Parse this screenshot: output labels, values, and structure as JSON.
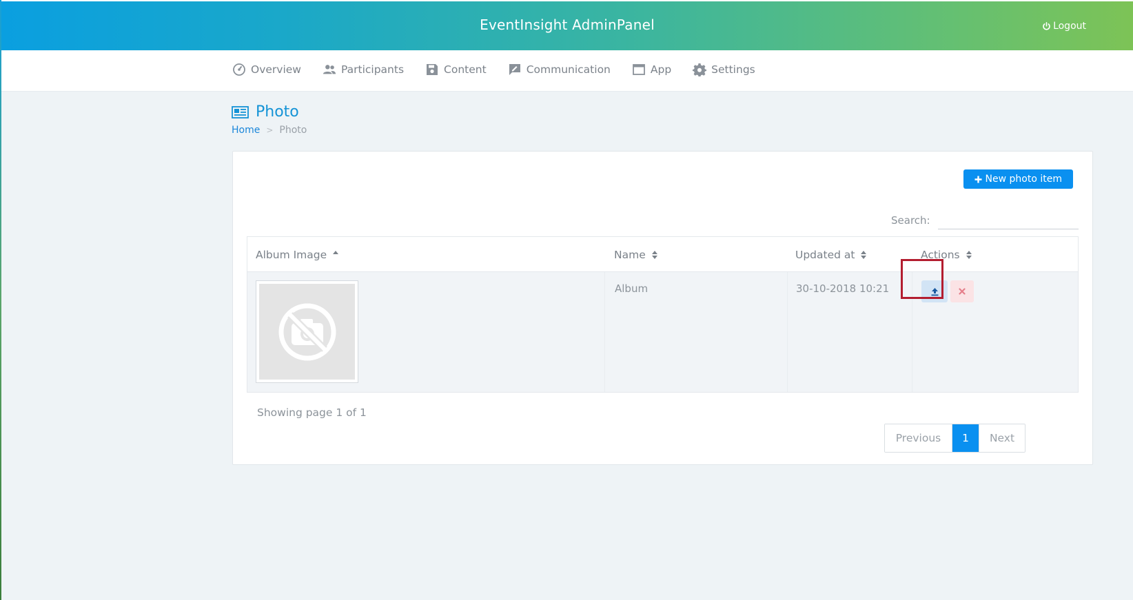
{
  "app": {
    "title": "EventInsight AdminPanel",
    "logout_label": "Logout"
  },
  "nav": {
    "items": [
      {
        "label": "Overview",
        "icon": "dashboard-icon"
      },
      {
        "label": "Participants",
        "icon": "users-icon"
      },
      {
        "label": "Content",
        "icon": "save-icon"
      },
      {
        "label": "Communication",
        "icon": "edit-message-icon"
      },
      {
        "label": "App",
        "icon": "window-icon"
      },
      {
        "label": "Settings",
        "icon": "gear-icon"
      }
    ]
  },
  "page": {
    "title": "Photo",
    "icon": "newspaper-icon",
    "breadcrumb": {
      "home": "Home",
      "separator": ">",
      "current": "Photo"
    }
  },
  "toolbar": {
    "new_button_label": "New photo item"
  },
  "search": {
    "label": "Search:",
    "value": ""
  },
  "table": {
    "columns": [
      "Album Image",
      "Name",
      "Updated at",
      "Actions"
    ],
    "rows": [
      {
        "image": "no-photo-icon",
        "name": "Album",
        "updated_at": "30-10-2018 10:21"
      }
    ]
  },
  "pagination": {
    "summary": "Showing page 1 of 1",
    "previous": "Previous",
    "current": "1",
    "next": "Next"
  },
  "colors": {
    "accent": "#0a90f0",
    "highlight": "#b31d2f",
    "header_gradient_start": "#0a9fe0",
    "header_gradient_end": "#7dc356"
  }
}
